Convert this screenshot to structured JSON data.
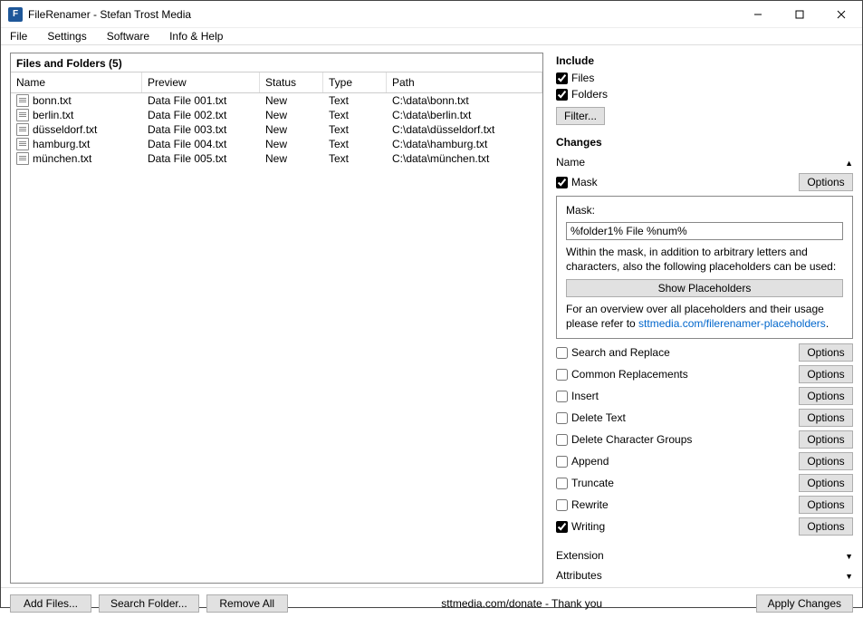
{
  "window": {
    "title": "FileRenamer - Stefan Trost Media",
    "icon_letter": "F"
  },
  "menu": {
    "file": "File",
    "settings": "Settings",
    "software": "Software",
    "info": "Info & Help"
  },
  "left": {
    "header": "Files and Folders (5)",
    "columns": {
      "name": "Name",
      "preview": "Preview",
      "status": "Status",
      "type": "Type",
      "path": "Path"
    },
    "rows": [
      {
        "name": "bonn.txt",
        "preview": "Data File 001.txt",
        "status": "New",
        "type": "Text",
        "path": "C:\\data\\bonn.txt"
      },
      {
        "name": "berlin.txt",
        "preview": "Data File 002.txt",
        "status": "New",
        "type": "Text",
        "path": "C:\\data\\berlin.txt"
      },
      {
        "name": "düsseldorf.txt",
        "preview": "Data File 003.txt",
        "status": "New",
        "type": "Text",
        "path": "C:\\data\\düsseldorf.txt"
      },
      {
        "name": "hamburg.txt",
        "preview": "Data File 004.txt",
        "status": "New",
        "type": "Text",
        "path": "C:\\data\\hamburg.txt"
      },
      {
        "name": "münchen.txt",
        "preview": "Data File 005.txt",
        "status": "New",
        "type": "Text",
        "path": "C:\\data\\münchen.txt"
      }
    ]
  },
  "include": {
    "title": "Include",
    "files": "Files",
    "folders": "Folders",
    "filter_btn": "Filter..."
  },
  "changes": {
    "title": "Changes",
    "name_section": "Name",
    "mask_label": "Mask",
    "options_btn": "Options",
    "panel": {
      "mask_field_label": "Mask:",
      "mask_value": "%folder1% File %num%",
      "note": "Within the mask, in addition to arbitrary letters and characters, also the following placeholders can be used:",
      "show_btn": "Show Placeholders",
      "overview_prefix": "For an overview over all placeholders and their usage please refer to ",
      "overview_link": "sttmedia.com/filerenamer-placeholders",
      "overview_suffix": "."
    },
    "ops": [
      {
        "label": "Search and Replace",
        "checked": false
      },
      {
        "label": "Common Replacements",
        "checked": false
      },
      {
        "label": "Insert",
        "checked": false
      },
      {
        "label": "Delete Text",
        "checked": false
      },
      {
        "label": "Delete Character Groups",
        "checked": false
      },
      {
        "label": "Append",
        "checked": false
      },
      {
        "label": "Truncate",
        "checked": false
      },
      {
        "label": "Rewrite",
        "checked": false
      },
      {
        "label": "Writing",
        "checked": true
      }
    ],
    "extension_section": "Extension",
    "attributes_section": "Attributes"
  },
  "bottom": {
    "add_files": "Add Files...",
    "search_folder": "Search Folder...",
    "remove_all": "Remove All",
    "donate": "sttmedia.com/donate - Thank you",
    "apply": "Apply Changes"
  }
}
